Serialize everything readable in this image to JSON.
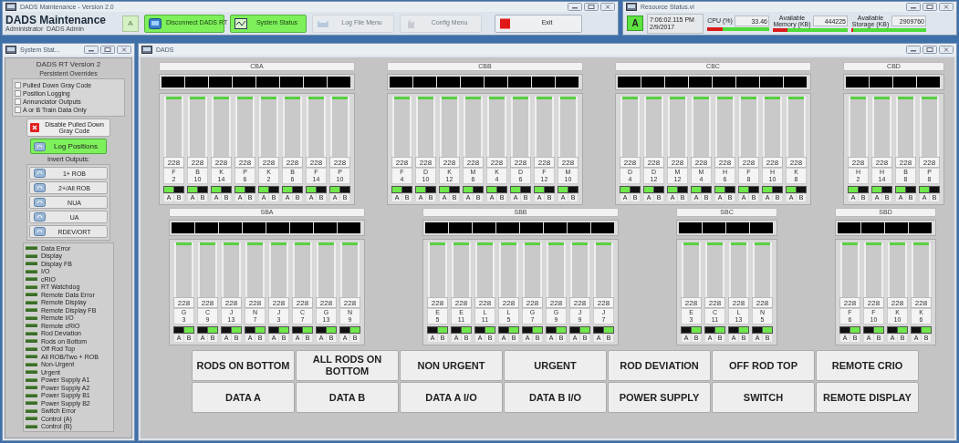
{
  "main_window": {
    "title": "DADS Maintenance - Version 2.0",
    "app_name": "DADS Maintenance",
    "user": "Administrator  DADS Admin",
    "mode": "A",
    "buttons": [
      {
        "label": "Disconnect DADS RT",
        "kind": "connect",
        "disabled": false
      },
      {
        "label": "System Status",
        "kind": "status",
        "disabled": false
      },
      {
        "label": "Log File Menu",
        "kind": "log",
        "disabled": true
      },
      {
        "label": "Config Menu",
        "kind": "config",
        "disabled": true
      },
      {
        "label": "Exit",
        "kind": "exit",
        "disabled": false
      }
    ]
  },
  "resource_window": {
    "title": "Resource Status.vi",
    "mode": "A",
    "time": "7:06:02.115 PM",
    "date": "2/9/2017",
    "meters": [
      {
        "label": "CPU (%)",
        "value": "33.46",
        "level": 0.25
      },
      {
        "label": "Available Memory (KB)",
        "value": "444225",
        "level": 0.2
      },
      {
        "label": "Available Storage (KB)",
        "value": "2909760",
        "level": 0.03
      }
    ]
  },
  "system_panel": {
    "title": "System Stat...",
    "heading": "DADS RT Version 2",
    "subheading": "Persistent Overrides",
    "overrides": [
      {
        "label": "Pulled Down Gray Code",
        "checked": false
      },
      {
        "label": "Position Logging",
        "checked": false
      },
      {
        "label": "Annunciator Outputs",
        "checked": false
      },
      {
        "label": "A or B Train Data Only",
        "checked": false
      }
    ],
    "disable_button": "Disable Pulled Down Gray Code",
    "log_button": "Log Positions",
    "invert_label": "Invert Outputs:",
    "invert_buttons": [
      "1+ ROB",
      "2+/All ROB",
      "NUA",
      "UA",
      "RDEV/ORT"
    ],
    "status_lights": [
      "Data Error",
      "Display",
      "Display FB",
      "I/O",
      "cRIO",
      "RT Watchdog",
      "Remote Data Error",
      "Remote Display",
      "Remote Display FB",
      "Remote I/O",
      "Remote cRIO",
      "Rod Deviation",
      "Rods on Bottom",
      "Off Rod Top",
      "All ROB/Two + ROB",
      "Non-Urgent",
      "Urgent",
      "Power Supply A1",
      "Power Supply A2",
      "Power Supply B1",
      "Power Supply B2",
      "Switch Error",
      "Control (A)",
      "Control (B)"
    ]
  },
  "dads_panel": {
    "title": "DADS",
    "rows": [
      [
        {
          "name": "CBA",
          "rods": [
            {
              "value": "228",
              "col": "F",
              "row": "2",
              "level": 1,
              "a_on": true,
              "b_on": false,
              "a": "A",
              "b": "B"
            },
            {
              "value": "228",
              "col": "B",
              "row": "10",
              "level": 1,
              "a_on": true,
              "b_on": false,
              "a": "A",
              "b": "B"
            },
            {
              "value": "228",
              "col": "K",
              "row": "14",
              "level": 1,
              "a_on": true,
              "b_on": false,
              "a": "A",
              "b": "B"
            },
            {
              "value": "228",
              "col": "P",
              "row": "6",
              "level": 1,
              "a_on": true,
              "b_on": false,
              "a": "A",
              "b": "B"
            },
            {
              "value": "228",
              "col": "K",
              "row": "2",
              "level": 1,
              "a_on": true,
              "b_on": false,
              "a": "A",
              "b": "B"
            },
            {
              "value": "228",
              "col": "B",
              "row": "6",
              "level": 1,
              "a_on": true,
              "b_on": false,
              "a": "A",
              "b": "B"
            },
            {
              "value": "228",
              "col": "F",
              "row": "14",
              "level": 1,
              "a_on": true,
              "b_on": false,
              "a": "A",
              "b": "B"
            },
            {
              "value": "228",
              "col": "P",
              "row": "10",
              "level": 1,
              "a_on": true,
              "b_on": false,
              "a": "A",
              "b": "B"
            }
          ]
        },
        {
          "name": "CBB",
          "rods": [
            {
              "value": "228",
              "col": "F",
              "row": "4",
              "level": 1,
              "a_on": true,
              "b_on": false,
              "a": "A",
              "b": "B"
            },
            {
              "value": "228",
              "col": "D",
              "row": "10",
              "level": 1,
              "a_on": true,
              "b_on": false,
              "a": "A",
              "b": "B"
            },
            {
              "value": "228",
              "col": "K",
              "row": "12",
              "level": 1,
              "a_on": true,
              "b_on": false,
              "a": "A",
              "b": "B"
            },
            {
              "value": "228",
              "col": "M",
              "row": "6",
              "level": 1,
              "a_on": true,
              "b_on": false,
              "a": "A",
              "b": "B"
            },
            {
              "value": "228",
              "col": "K",
              "row": "4",
              "level": 1,
              "a_on": true,
              "b_on": false,
              "a": "A",
              "b": "B"
            },
            {
              "value": "228",
              "col": "D",
              "row": "6",
              "level": 1,
              "a_on": true,
              "b_on": false,
              "a": "A",
              "b": "B"
            },
            {
              "value": "228",
              "col": "F",
              "row": "12",
              "level": 1,
              "a_on": true,
              "b_on": false,
              "a": "A",
              "b": "B"
            },
            {
              "value": "228",
              "col": "M",
              "row": "10",
              "level": 1,
              "a_on": true,
              "b_on": false,
              "a": "A",
              "b": "B"
            }
          ]
        },
        {
          "name": "CBC",
          "rods": [
            {
              "value": "228",
              "col": "D",
              "row": "4",
              "level": 1,
              "a_on": true,
              "b_on": false,
              "a": "A",
              "b": "B"
            },
            {
              "value": "228",
              "col": "D",
              "row": "12",
              "level": 1,
              "a_on": true,
              "b_on": false,
              "a": "A",
              "b": "B"
            },
            {
              "value": "228",
              "col": "M",
              "row": "12",
              "level": 1,
              "a_on": true,
              "b_on": false,
              "a": "A",
              "b": "B"
            },
            {
              "value": "228",
              "col": "M",
              "row": "4",
              "level": 1,
              "a_on": true,
              "b_on": false,
              "a": "A",
              "b": "B"
            },
            {
              "value": "228",
              "col": "H",
              "row": "6",
              "level": 1,
              "a_on": true,
              "b_on": false,
              "a": "A",
              "b": "B"
            },
            {
              "value": "228",
              "col": "F",
              "row": "8",
              "level": 1,
              "a_on": true,
              "b_on": false,
              "a": "A",
              "b": "B"
            },
            {
              "value": "228",
              "col": "H",
              "row": "10",
              "level": 1,
              "a_on": true,
              "b_on": false,
              "a": "A",
              "b": "B"
            },
            {
              "value": "228",
              "col": "K",
              "row": "8",
              "level": 1,
              "a_on": true,
              "b_on": false,
              "a": "A",
              "b": "B"
            }
          ]
        },
        {
          "name": "CBD",
          "rods": [
            {
              "value": "228",
              "col": "H",
              "row": "2",
              "level": 1,
              "a_on": true,
              "b_on": false,
              "a": "A",
              "b": "B"
            },
            {
              "value": "228",
              "col": "H",
              "row": "14",
              "level": 1,
              "a_on": true,
              "b_on": false,
              "a": "A",
              "b": "B"
            },
            {
              "value": "228",
              "col": "B",
              "row": "8",
              "level": 1,
              "a_on": true,
              "b_on": false,
              "a": "A",
              "b": "B"
            },
            {
              "value": "228",
              "col": "P",
              "row": "8",
              "level": 1,
              "a_on": true,
              "b_on": false,
              "a": "A",
              "b": "B"
            }
          ]
        }
      ],
      [
        {
          "name": "SBA",
          "rods": [
            {
              "value": "228",
              "col": "G",
              "row": "3",
              "level": 1,
              "a_on": false,
              "b_on": true,
              "a": "A",
              "b": "B"
            },
            {
              "value": "228",
              "col": "C",
              "row": "9",
              "level": 1,
              "a_on": false,
              "b_on": true,
              "a": "A",
              "b": "B"
            },
            {
              "value": "228",
              "col": "J",
              "row": "13",
              "level": 1,
              "a_on": false,
              "b_on": true,
              "a": "A",
              "b": "B"
            },
            {
              "value": "228",
              "col": "N",
              "row": "7",
              "level": 1,
              "a_on": false,
              "b_on": true,
              "a": "A",
              "b": "B"
            },
            {
              "value": "228",
              "col": "J",
              "row": "3",
              "level": 1,
              "a_on": false,
              "b_on": true,
              "a": "A",
              "b": "B"
            },
            {
              "value": "228",
              "col": "C",
              "row": "7",
              "level": 1,
              "a_on": false,
              "b_on": true,
              "a": "A",
              "b": "B"
            },
            {
              "value": "228",
              "col": "G",
              "row": "13",
              "level": 1,
              "a_on": false,
              "b_on": true,
              "a": "A",
              "b": "B"
            },
            {
              "value": "228",
              "col": "N",
              "row": "9",
              "level": 1,
              "a_on": false,
              "b_on": true,
              "a": "A",
              "b": "B"
            }
          ]
        },
        {
          "name": "SBB",
          "rods": [
            {
              "value": "228",
              "col": "E",
              "row": "5",
              "level": 1,
              "a_on": false,
              "b_on": true,
              "a": "A",
              "b": "B"
            },
            {
              "value": "228",
              "col": "E",
              "row": "11",
              "level": 1,
              "a_on": false,
              "b_on": true,
              "a": "A",
              "b": "B"
            },
            {
              "value": "228",
              "col": "L",
              "row": "11",
              "level": 1,
              "a_on": false,
              "b_on": true,
              "a": "A",
              "b": "B"
            },
            {
              "value": "228",
              "col": "L",
              "row": "5",
              "level": 1,
              "a_on": false,
              "b_on": true,
              "a": "A",
              "b": "B"
            },
            {
              "value": "228",
              "col": "G",
              "row": "7",
              "level": 1,
              "a_on": false,
              "b_on": true,
              "a": "A",
              "b": "B"
            },
            {
              "value": "228",
              "col": "G",
              "row": "9",
              "level": 1,
              "a_on": false,
              "b_on": true,
              "a": "A",
              "b": "B"
            },
            {
              "value": "228",
              "col": "J",
              "row": "9",
              "level": 1,
              "a_on": false,
              "b_on": true,
              "a": "A",
              "b": "B"
            },
            {
              "value": "228",
              "col": "J",
              "row": "7",
              "level": 1,
              "a_on": false,
              "b_on": true,
              "a": "A",
              "b": "B"
            }
          ]
        },
        {
          "name": "SBC",
          "rods": [
            {
              "value": "228",
              "col": "E",
              "row": "3",
              "level": 1,
              "a_on": false,
              "b_on": true,
              "a": "A",
              "b": "B"
            },
            {
              "value": "228",
              "col": "C",
              "row": "11",
              "level": 1,
              "a_on": false,
              "b_on": true,
              "a": "A",
              "b": "B"
            },
            {
              "value": "228",
              "col": "L",
              "row": "13",
              "level": 1,
              "a_on": false,
              "b_on": true,
              "a": "A",
              "b": "B"
            },
            {
              "value": "228",
              "col": "N",
              "row": "5",
              "level": 1,
              "a_on": false,
              "b_on": true,
              "a": "A",
              "b": "B"
            }
          ]
        },
        {
          "name": "SBD",
          "rods": [
            {
              "value": "228",
              "col": "F",
              "row": "6",
              "level": 1,
              "a_on": false,
              "b_on": true,
              "a": "A",
              "b": "B"
            },
            {
              "value": "228",
              "col": "F",
              "row": "10",
              "level": 1,
              "a_on": false,
              "b_on": true,
              "a": "A",
              "b": "B"
            },
            {
              "value": "228",
              "col": "K",
              "row": "10",
              "level": 1,
              "a_on": false,
              "b_on": true,
              "a": "A",
              "b": "B"
            },
            {
              "value": "228",
              "col": "K",
              "row": "6",
              "level": 1,
              "a_on": false,
              "b_on": true,
              "a": "A",
              "b": "B"
            }
          ]
        }
      ]
    ],
    "alarm_buttons": [
      "RODS ON BOTTOM",
      "ALL RODS ON BOTTOM",
      "NON URGENT",
      "URGENT",
      "ROD DEVIATION",
      "OFF ROD TOP",
      "REMOTE CRIO",
      "DATA A",
      "DATA B",
      "DATA A I/O",
      "DATA B I/O",
      "POWER SUPPLY",
      "SWITCH",
      "REMOTE DISPLAY"
    ]
  }
}
